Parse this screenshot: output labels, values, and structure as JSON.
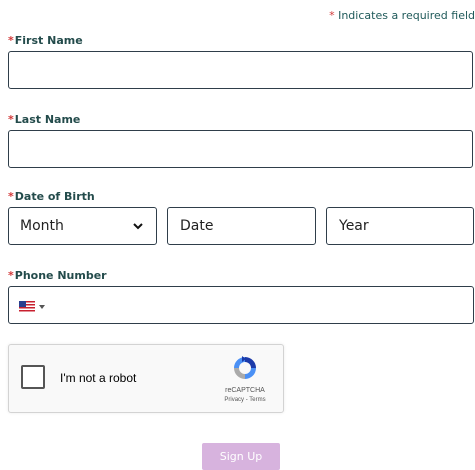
{
  "required_note": {
    "star": "*",
    "text": " Indicates a required field"
  },
  "first_name": {
    "star": "*",
    "label": "First Name",
    "value": ""
  },
  "last_name": {
    "star": "*",
    "label": "Last Name",
    "value": ""
  },
  "dob": {
    "star": "*",
    "label": "Date of Birth",
    "month_placeholder": "Month",
    "date_placeholder": "Date",
    "year_placeholder": "Year"
  },
  "phone": {
    "star": "*",
    "label": "Phone Number",
    "country_icon": "us-flag-icon",
    "value": ""
  },
  "captcha": {
    "checkbox_label": "I'm not a robot",
    "brand": "reCAPTCHA",
    "privacy": "Privacy",
    "separator": " - ",
    "terms": "Terms"
  },
  "signup_button": {
    "label": "Sign Up",
    "color": "#d7b3de"
  },
  "colors": {
    "required_star": "#d23a3a",
    "label": "#234b4b",
    "border": "#2f3e4a"
  }
}
